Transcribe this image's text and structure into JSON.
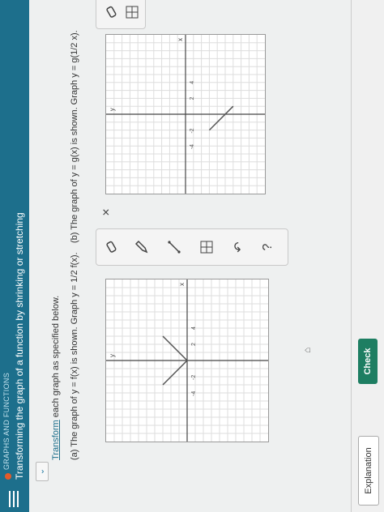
{
  "header": {
    "breadcrumb": "GRAPHS AND FUNCTIONS",
    "title": "Transforming the graph of a function by shrinking or stretching"
  },
  "instruction": {
    "lead": "Transform",
    "rest": " each graph as specified below."
  },
  "part_a": {
    "label": "(a) The graph of y = f(x) is shown. Graph y = 1/2 f(x).",
    "graph_ticks": [
      "-4",
      "-2",
      "2",
      "4"
    ],
    "axis_x": "x",
    "axis_y": "y"
  },
  "part_b": {
    "label": "(b) The graph of y = g(x) is shown. Graph y = g(1/2 x).",
    "graph_ticks": [
      "-4",
      "-2",
      "2",
      "4"
    ],
    "axis_x": "x",
    "axis_y": "y"
  },
  "toolbox": {
    "eraser": "eraser-tool",
    "pencil": "pencil-tool",
    "line": "line-tool",
    "grid": "grid-tool",
    "undo": "↶",
    "help": "?",
    "close": "×"
  },
  "footer": {
    "explanation": "Explanation",
    "check": "Check"
  }
}
